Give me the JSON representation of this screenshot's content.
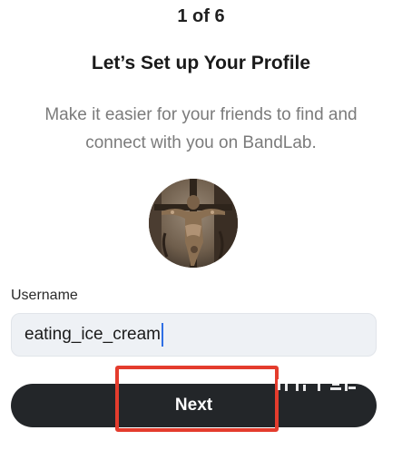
{
  "progress": {
    "step_text": "1 of 6"
  },
  "header": {
    "title": "Let’s Set up Your Profile",
    "subtitle_line1": "Make it easier for your friends to find and",
    "subtitle_line2": "connect with you on BandLab."
  },
  "avatar": {
    "icon": "profile-photo"
  },
  "form": {
    "username_label": "Username",
    "username_value": "eating_ice_cream"
  },
  "actions": {
    "next_label": "Next"
  },
  "colors": {
    "button_bg": "#232629",
    "field_bg": "#eef1f5",
    "highlight": "#e43c2d",
    "caret": "#2f6fe4"
  }
}
